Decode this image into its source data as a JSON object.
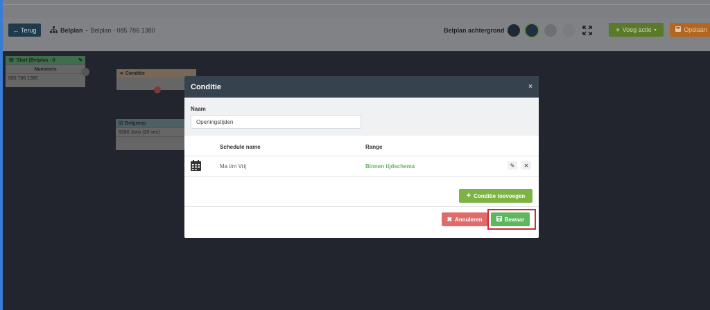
{
  "toolbar": {
    "back_label": "← Terug",
    "breadcrumb_title": "Belplan",
    "breadcrumb_sep": "-",
    "breadcrumb_sub": "Belplan - 085 786 1380",
    "background_label": "Belplan achtergrond",
    "add_action_label": "Voeg actie",
    "save_label": "Opslaan",
    "swatch_colors": [
      "#1c2a36",
      "#203040",
      "#6d6f72",
      "#7a7c7f"
    ]
  },
  "canvas": {
    "start_node": {
      "title": "Start (Belplan - 0",
      "section": "Nummers",
      "number": "085 786 1380",
      "color": "#3e6e4c"
    },
    "condition_node": {
      "title": "Conditie",
      "color": "#77685a"
    },
    "group_node": {
      "title": "Belgroep",
      "member": "9280 Joris (20 sec)",
      "color": "#4d6064"
    }
  },
  "modal": {
    "title": "Conditie",
    "close_label": "×",
    "name_label": "Naam",
    "name_value": "Openingstijden",
    "columns": {
      "schedule": "Schedule name",
      "range": "Range"
    },
    "rows": [
      {
        "schedule": "Ma t/m Vrij",
        "range": "Binnen tijdschema"
      }
    ],
    "add_condition_label": "Conditie toevoegen",
    "cancel_label": "Annuleren",
    "save_label": "Bewaar"
  },
  "colors": {
    "accent_green": "#5cb85c",
    "cancel_red": "#e06b6b",
    "highlight": "#d8242f"
  }
}
